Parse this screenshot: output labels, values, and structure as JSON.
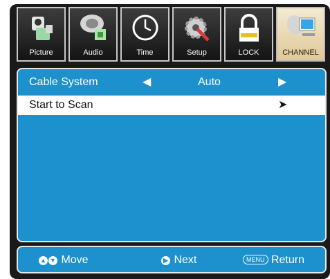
{
  "tabs": [
    {
      "label": "Picture",
      "icon": "camera-icon"
    },
    {
      "label": "Audio",
      "icon": "audio-icon"
    },
    {
      "label": "Time",
      "icon": "clock-icon"
    },
    {
      "label": "Setup",
      "icon": "gear-icon"
    },
    {
      "label": "LOCK",
      "icon": "lock-icon"
    },
    {
      "label": "CHANNEL",
      "icon": "satellite-dish-icon"
    }
  ],
  "active_tab": "CHANNEL",
  "menu": {
    "cable_system_label": "Cable System",
    "cable_system_value": "Auto",
    "start_scan_label": "Start to Scan"
  },
  "footer": {
    "move_label": "Move",
    "next_label": "Next",
    "menu_key": "MENU",
    "return_label": "Return"
  },
  "colors": {
    "panel_blue": "#1d91cd",
    "frame_dark": "#1a1a1a",
    "active_tab": "#f0e2bf"
  }
}
